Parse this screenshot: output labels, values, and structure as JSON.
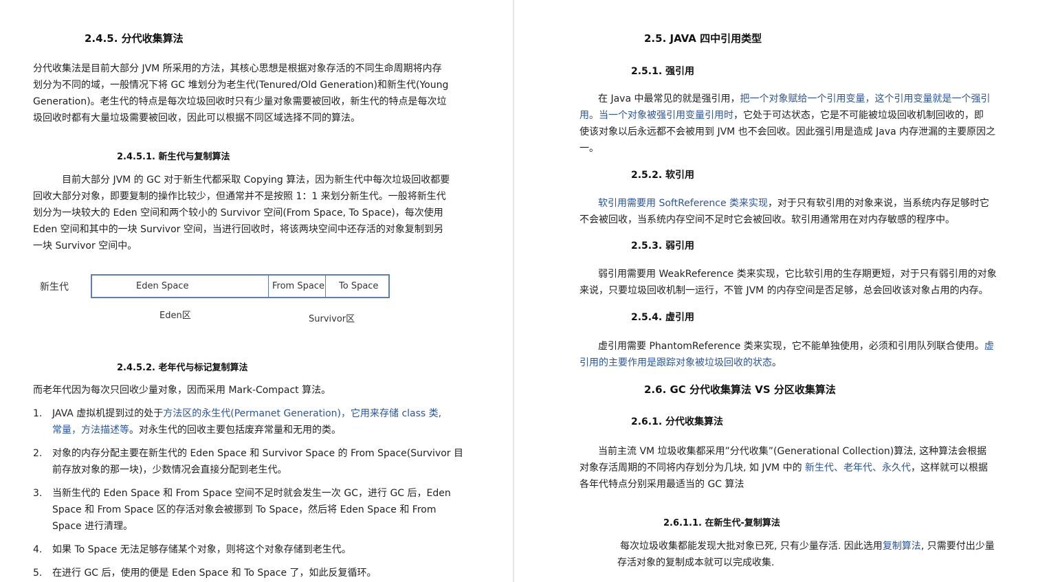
{
  "left": {
    "h_245": "2.4.5. 分代收集算法",
    "p1": [
      "分代收集法是目前大部分 JVM 所采用的方法，其核心思想是根据对象存活的不同生命周期将内存",
      "划分为不同的域，一般情况下将 GC 堆划分为老生代(Tenured/Old Generation)和新生代(Young",
      "Generation)。老生代的特点是每次垃圾回收时只有少量对象需要被回收，新生代的特点是每次垃",
      "圾回收时都有大量垃圾需要被回收，因此可以根据不同区域选择不同的算法。"
    ],
    "h_2451": "2.4.5.1.    新生代与复制算法",
    "p2": [
      "目前大部分 JVM 的 GC 对于新生代都采取 Copying 算法，因为新生代中每次垃圾回收都要",
      "回收大部分对象，即要复制的操作比较少，但通常并不是按照 1：1 来划分新生代。一般将新生代",
      "划分为一块较大的 Eden 空间和两个较小的 Survivor 空间(From Space, To Space)，每次使用",
      "Eden 空间和其中的一块 Survivor 空间，当进行回收时，将该两块空间中还存活的对象复制到另",
      "一块 Survivor 空间中。"
    ],
    "diagram": {
      "label_young": "新生代",
      "eden_space": "Eden Space",
      "from_space": "From Space",
      "to_space": "To Space",
      "eden_area": "Eden区",
      "survivor_area": "Survivor区"
    },
    "h_2452": "2.4.5.2.    老年代与标记复制算法",
    "p3": "而老年代因为每次只回收少量对象，因而采用 Mark-Compact 算法。",
    "list": [
      {
        "num": "1.",
        "l1a": "JAVA 虚拟机提到过的处于",
        "l1b": "方法区的永生代(Permanet Generation)，它用来存储 class 类,",
        "l2a": "常量，方法描述等",
        "l2b": "。对永生代的回收主要包括废弃常量和无用的类。"
      },
      {
        "num": "2.",
        "l1": "对象的内存分配主要在新生代的 Eden Space 和 Survivor Space 的 From Space(Survivor 目",
        "l2": "前存放对象的那一块)，少数情况会直接分配到老生代。"
      },
      {
        "num": "3.",
        "l1": "当新生代的 Eden Space 和 From Space 空间不足时就会发生一次 GC，进行 GC 后，Eden",
        "l2": "Space 和 From Space 区的存活对象会被挪到 To Space，然后将 Eden Space 和 From",
        "l3": "Space 进行清理。"
      },
      {
        "num": "4.",
        "l1": "如果 To Space 无法足够存储某个对象，则将这个对象存储到老生代。"
      },
      {
        "num": "5.",
        "l1": "在进行 GC 后，使用的便是 Eden Space 和 To Space 了，如此反复循环。"
      }
    ]
  },
  "right": {
    "h_25": "2.5. JAVA 四中引用类型",
    "h_251": "2.5.1.  强引用",
    "p251": {
      "l1a": "在 Java 中最常见的就是强引用，",
      "l1b": "把一个对象赋给一个引用变量，这个引用变量就是一个强引",
      "l2a": "用。当一个对象被强引用变量引用时",
      "l2b": "，它处于可达状态，它是不可能被垃圾回收机制回收的，即",
      "l3": "使该对象以后永远都不会被用到 JVM 也不会回收。因此强引用是造成 Java 内存泄漏的主要原因之",
      "l4": "一。"
    },
    "h_252": "2.5.2.  软引用",
    "p252": {
      "l1a": "软引用需要用 SoftReference 类来实现",
      "l1b": "，对于只有软引用的对象来说，当系统内存足够时它",
      "l2": "不会被回收，当系统内存空间不足时它会被回收。软引用通常用在对内存敏感的程序中。"
    },
    "h_253": "2.5.3.  弱引用",
    "p253": {
      "l1": "弱引用需要用 WeakReference 类来实现，它比软引用的生存期更短，对于只有弱引用的对象",
      "l2": "来说，只要垃圾回收机制一运行，不管 JVM 的内存空间是否足够，总会回收该对象占用的内存。"
    },
    "h_254": "2.5.4.  虚引用",
    "p254": {
      "l1a": "虚引用需要 PhantomReference 类来实现，它不能单独使用，必须和引用队列联合使用。",
      "l1b": "虚",
      "l2": "引用的主要作用是跟踪对象被垃圾回收的状态",
      "l2b": "。"
    },
    "h_26": "2.6. GC 分代收集算法  VS 分区收集算法",
    "h_261": "2.6.1.  分代收集算法",
    "p261": {
      "l1": "当前主流 VM 垃圾收集都采用”分代收集”(Generational Collection)算法, 这种算法会根据",
      "l2a": "对象存活周期的不同将内存划分为几块, 如 JVM 中的 ",
      "l2b": "新生代、老年代、永久代",
      "l2c": "，这样就可以根据",
      "l3": "各年代特点分别采用最适当的 GC 算法"
    },
    "h_2611": "2.6.1.1.    在新生代-复制算法",
    "p2611": {
      "l1a": "每次垃圾收集都能发现大批对象已死, 只有少量存活. 因此选用",
      "l1b": "复制算法",
      "l1c": ", 只需要付出少量",
      "l2": "存活对象的复制成本就可以完成收集."
    }
  }
}
